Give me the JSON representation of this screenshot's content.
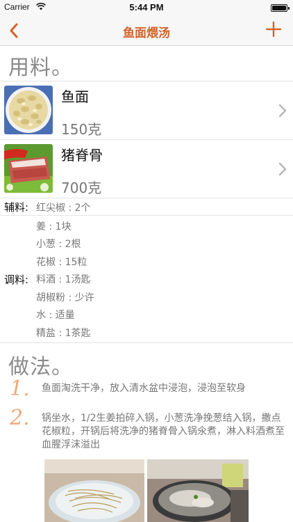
{
  "status": {
    "carrier": "Carrier",
    "time": "5:44 PM"
  },
  "nav": {
    "title": "鱼面煨汤"
  },
  "ingredients_heading": "用料。",
  "main_ingredients": [
    {
      "name": "鱼面",
      "qty": "150克"
    },
    {
      "name": "猪脊骨",
      "qty": "700克"
    }
  ],
  "aux": {
    "label": "辅料:",
    "items": [
      "红尖椒 : 2个"
    ]
  },
  "seasoning": {
    "label": "调料:",
    "items": [
      "姜 : 1块",
      "小葱 : 2根",
      "花椒 : 15粒",
      "料酒 : 1汤匙",
      "胡椒粉 : 少许",
      "水 : 适量",
      "精盐 : 1茶匙"
    ]
  },
  "method_heading": "做法。",
  "steps": [
    {
      "num": "1.",
      "text": "鱼面淘洗干净，放入清水盆中浸泡，浸泡至软身"
    },
    {
      "num": "2.",
      "text": "锅坐水，1/2生姜拍碎入锅，小葱洗净挽葱结入锅，撒点花椒粒，开锅后将洗净的猪脊骨入锅氽煮，淋入料酒煮至血腥浮沫溢出"
    }
  ],
  "colors": {
    "accent": "#d5622a",
    "step_number": "#f0a978"
  }
}
